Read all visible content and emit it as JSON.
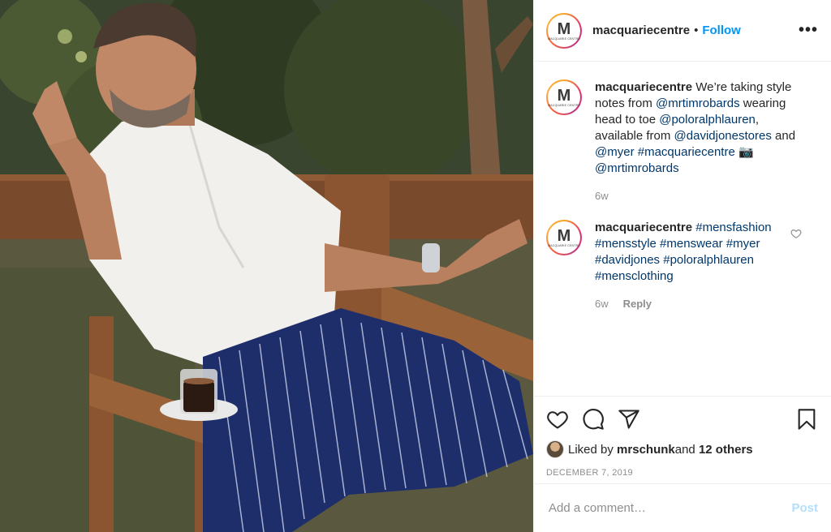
{
  "photo": {
    "alt": ""
  },
  "header": {
    "username": "macquariecentre",
    "separator": "•",
    "follow_label": "Follow",
    "more_label": "•••"
  },
  "avatar": {
    "letter": "M",
    "subtitle": "MACQUARIE CENTRE"
  },
  "caption": {
    "username": "macquariecentre",
    "t1": " We’re taking style notes from ",
    "m1": "@mrtimrobards",
    "t2": " wearing head to toe ",
    "m2": "@poloralphlauren",
    "t3": ", available from ",
    "m3": "@davidjonestores",
    "t4": " and ",
    "m4": "@myer",
    "t5": " ",
    "h1": "#macquariecentre",
    "t6": " 📷 ",
    "m5": "@mrtimrobards",
    "time": "6w"
  },
  "comment": {
    "username": "macquariecentre",
    "hashtags": [
      "#mensfashion",
      "#mensstyle",
      "#menswear",
      "#myer",
      "#davidjones",
      "#poloralphlauren",
      "#mensclothing"
    ],
    "time": "6w",
    "reply_label": "Reply"
  },
  "likes": {
    "prefix": "Liked by ",
    "user": "mrschunk",
    "middle": " and ",
    "others": "12 others"
  },
  "date": "DECEMBER 7, 2019",
  "add_comment": {
    "placeholder": "Add a comment…",
    "post_label": "Post"
  },
  "colors": {
    "link": "#00376b",
    "follow": "#0095f6",
    "post_disabled": "#b2dffc",
    "muted": "#8e8e8e"
  },
  "icons": [
    "heart-icon",
    "comment-icon",
    "share-icon",
    "bookmark-icon",
    "more-icon"
  ]
}
